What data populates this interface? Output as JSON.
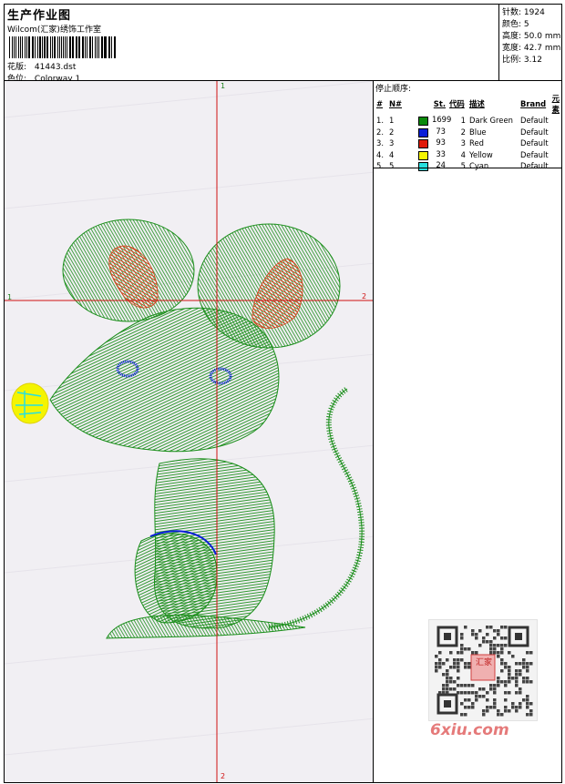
{
  "header": {
    "title": "生产作业图",
    "studio": "Wilcom(汇家)绣饰工作室",
    "design_label": "花版:",
    "design_value": "41443.dst",
    "colorway_label": "色位:",
    "colorway_value": "Colorway 1"
  },
  "stats": [
    {
      "label": "针数:",
      "value": "1924"
    },
    {
      "label": "颜色:",
      "value": "5"
    },
    {
      "label": "高度:",
      "value": "50.0 mm"
    },
    {
      "label": "宽度:",
      "value": "42.7 mm"
    },
    {
      "label": "比例:",
      "value": "3.12"
    }
  ],
  "canvas": {
    "marker_top": "1",
    "marker_left": "1",
    "marker_right": "2",
    "marker_bottom": "2"
  },
  "sequence": {
    "title": "停止顺序:",
    "headers": [
      "#",
      "N#",
      "St.",
      "代码",
      "描述",
      "Brand",
      "元素"
    ],
    "rows": [
      {
        "num": "1.",
        "n": "1",
        "color": "#0a8a0a",
        "stitches": "1699",
        "code": "1",
        "desc": "Dark Green",
        "brand": "Default"
      },
      {
        "num": "2.",
        "n": "2",
        "color": "#0a1ed8",
        "stitches": "73",
        "code": "2",
        "desc": "Blue",
        "brand": "Default"
      },
      {
        "num": "3.",
        "n": "3",
        "color": "#e01a0a",
        "stitches": "93",
        "code": "3",
        "desc": "Red",
        "brand": "Default"
      },
      {
        "num": "4.",
        "n": "4",
        "color": "#f4f400",
        "stitches": "33",
        "code": "4",
        "desc": "Yellow",
        "brand": "Default"
      },
      {
        "num": "5.",
        "n": "5",
        "color": "#26e0e0",
        "stitches": "24",
        "code": "5",
        "desc": "Cyan",
        "brand": "Default"
      }
    ]
  },
  "watermark": {
    "text": "6xiu.com",
    "stamp": "汇家"
  }
}
